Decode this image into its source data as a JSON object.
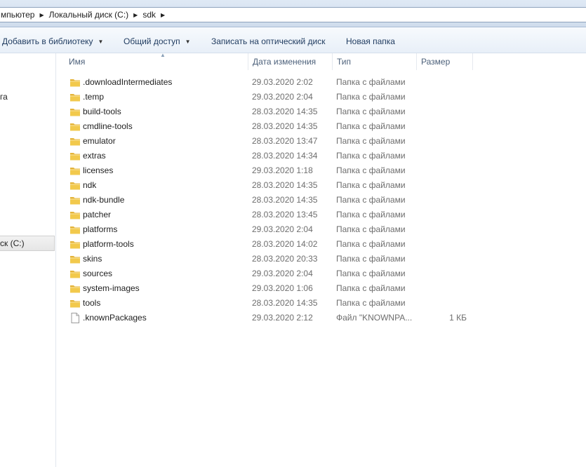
{
  "addressbar": {
    "crumbs": [
      "мпьютер",
      "Локальный диск (C:)",
      "sdk"
    ]
  },
  "toolbar": {
    "library_label": "Добавить в библиотеку",
    "share_label": "Общий доступ",
    "burn_label": "Записать на оптический диск",
    "new_folder_label": "Новая папка"
  },
  "navpane": {
    "partial_item": "га",
    "selected_item": "ск (C:)"
  },
  "columns": {
    "name": "Имя",
    "date": "Дата изменения",
    "type": "Тип",
    "size": "Размер"
  },
  "files": [
    {
      "name": ".downloadIntermediates",
      "date": "29.03.2020 2:02",
      "type": "Папка с файлами",
      "size": "",
      "icon": "folder-icon"
    },
    {
      "name": ".temp",
      "date": "29.03.2020 2:04",
      "type": "Папка с файлами",
      "size": "",
      "icon": "folder-icon"
    },
    {
      "name": "build-tools",
      "date": "28.03.2020 14:35",
      "type": "Папка с файлами",
      "size": "",
      "icon": "folder-icon"
    },
    {
      "name": "cmdline-tools",
      "date": "28.03.2020 14:35",
      "type": "Папка с файлами",
      "size": "",
      "icon": "folder-icon"
    },
    {
      "name": "emulator",
      "date": "28.03.2020 13:47",
      "type": "Папка с файлами",
      "size": "",
      "icon": "folder-icon"
    },
    {
      "name": "extras",
      "date": "28.03.2020 14:34",
      "type": "Папка с файлами",
      "size": "",
      "icon": "folder-icon"
    },
    {
      "name": "licenses",
      "date": "29.03.2020 1:18",
      "type": "Папка с файлами",
      "size": "",
      "icon": "folder-icon"
    },
    {
      "name": "ndk",
      "date": "28.03.2020 14:35",
      "type": "Папка с файлами",
      "size": "",
      "icon": "folder-icon"
    },
    {
      "name": "ndk-bundle",
      "date": "28.03.2020 14:35",
      "type": "Папка с файлами",
      "size": "",
      "icon": "folder-icon"
    },
    {
      "name": "patcher",
      "date": "28.03.2020 13:45",
      "type": "Папка с файлами",
      "size": "",
      "icon": "folder-icon"
    },
    {
      "name": "platforms",
      "date": "29.03.2020 2:04",
      "type": "Папка с файлами",
      "size": "",
      "icon": "folder-icon"
    },
    {
      "name": "platform-tools",
      "date": "28.03.2020 14:02",
      "type": "Папка с файлами",
      "size": "",
      "icon": "folder-icon"
    },
    {
      "name": "skins",
      "date": "28.03.2020 20:33",
      "type": "Папка с файлами",
      "size": "",
      "icon": "folder-icon"
    },
    {
      "name": "sources",
      "date": "29.03.2020 2:04",
      "type": "Папка с файлами",
      "size": "",
      "icon": "folder-icon"
    },
    {
      "name": "system-images",
      "date": "29.03.2020 1:06",
      "type": "Папка с файлами",
      "size": "",
      "icon": "folder-icon"
    },
    {
      "name": "tools",
      "date": "28.03.2020 14:35",
      "type": "Папка с файлами",
      "size": "",
      "icon": "folder-icon"
    },
    {
      "name": ".knownPackages",
      "date": "29.03.2020 2:12",
      "type": "Файл \"KNOWNPA...",
      "size": "1 КБ",
      "icon": "file-icon"
    }
  ],
  "colors": {
    "folder": "#f2c94c",
    "header_text": "#4c607a",
    "meta_text": "#6d6d6d"
  }
}
